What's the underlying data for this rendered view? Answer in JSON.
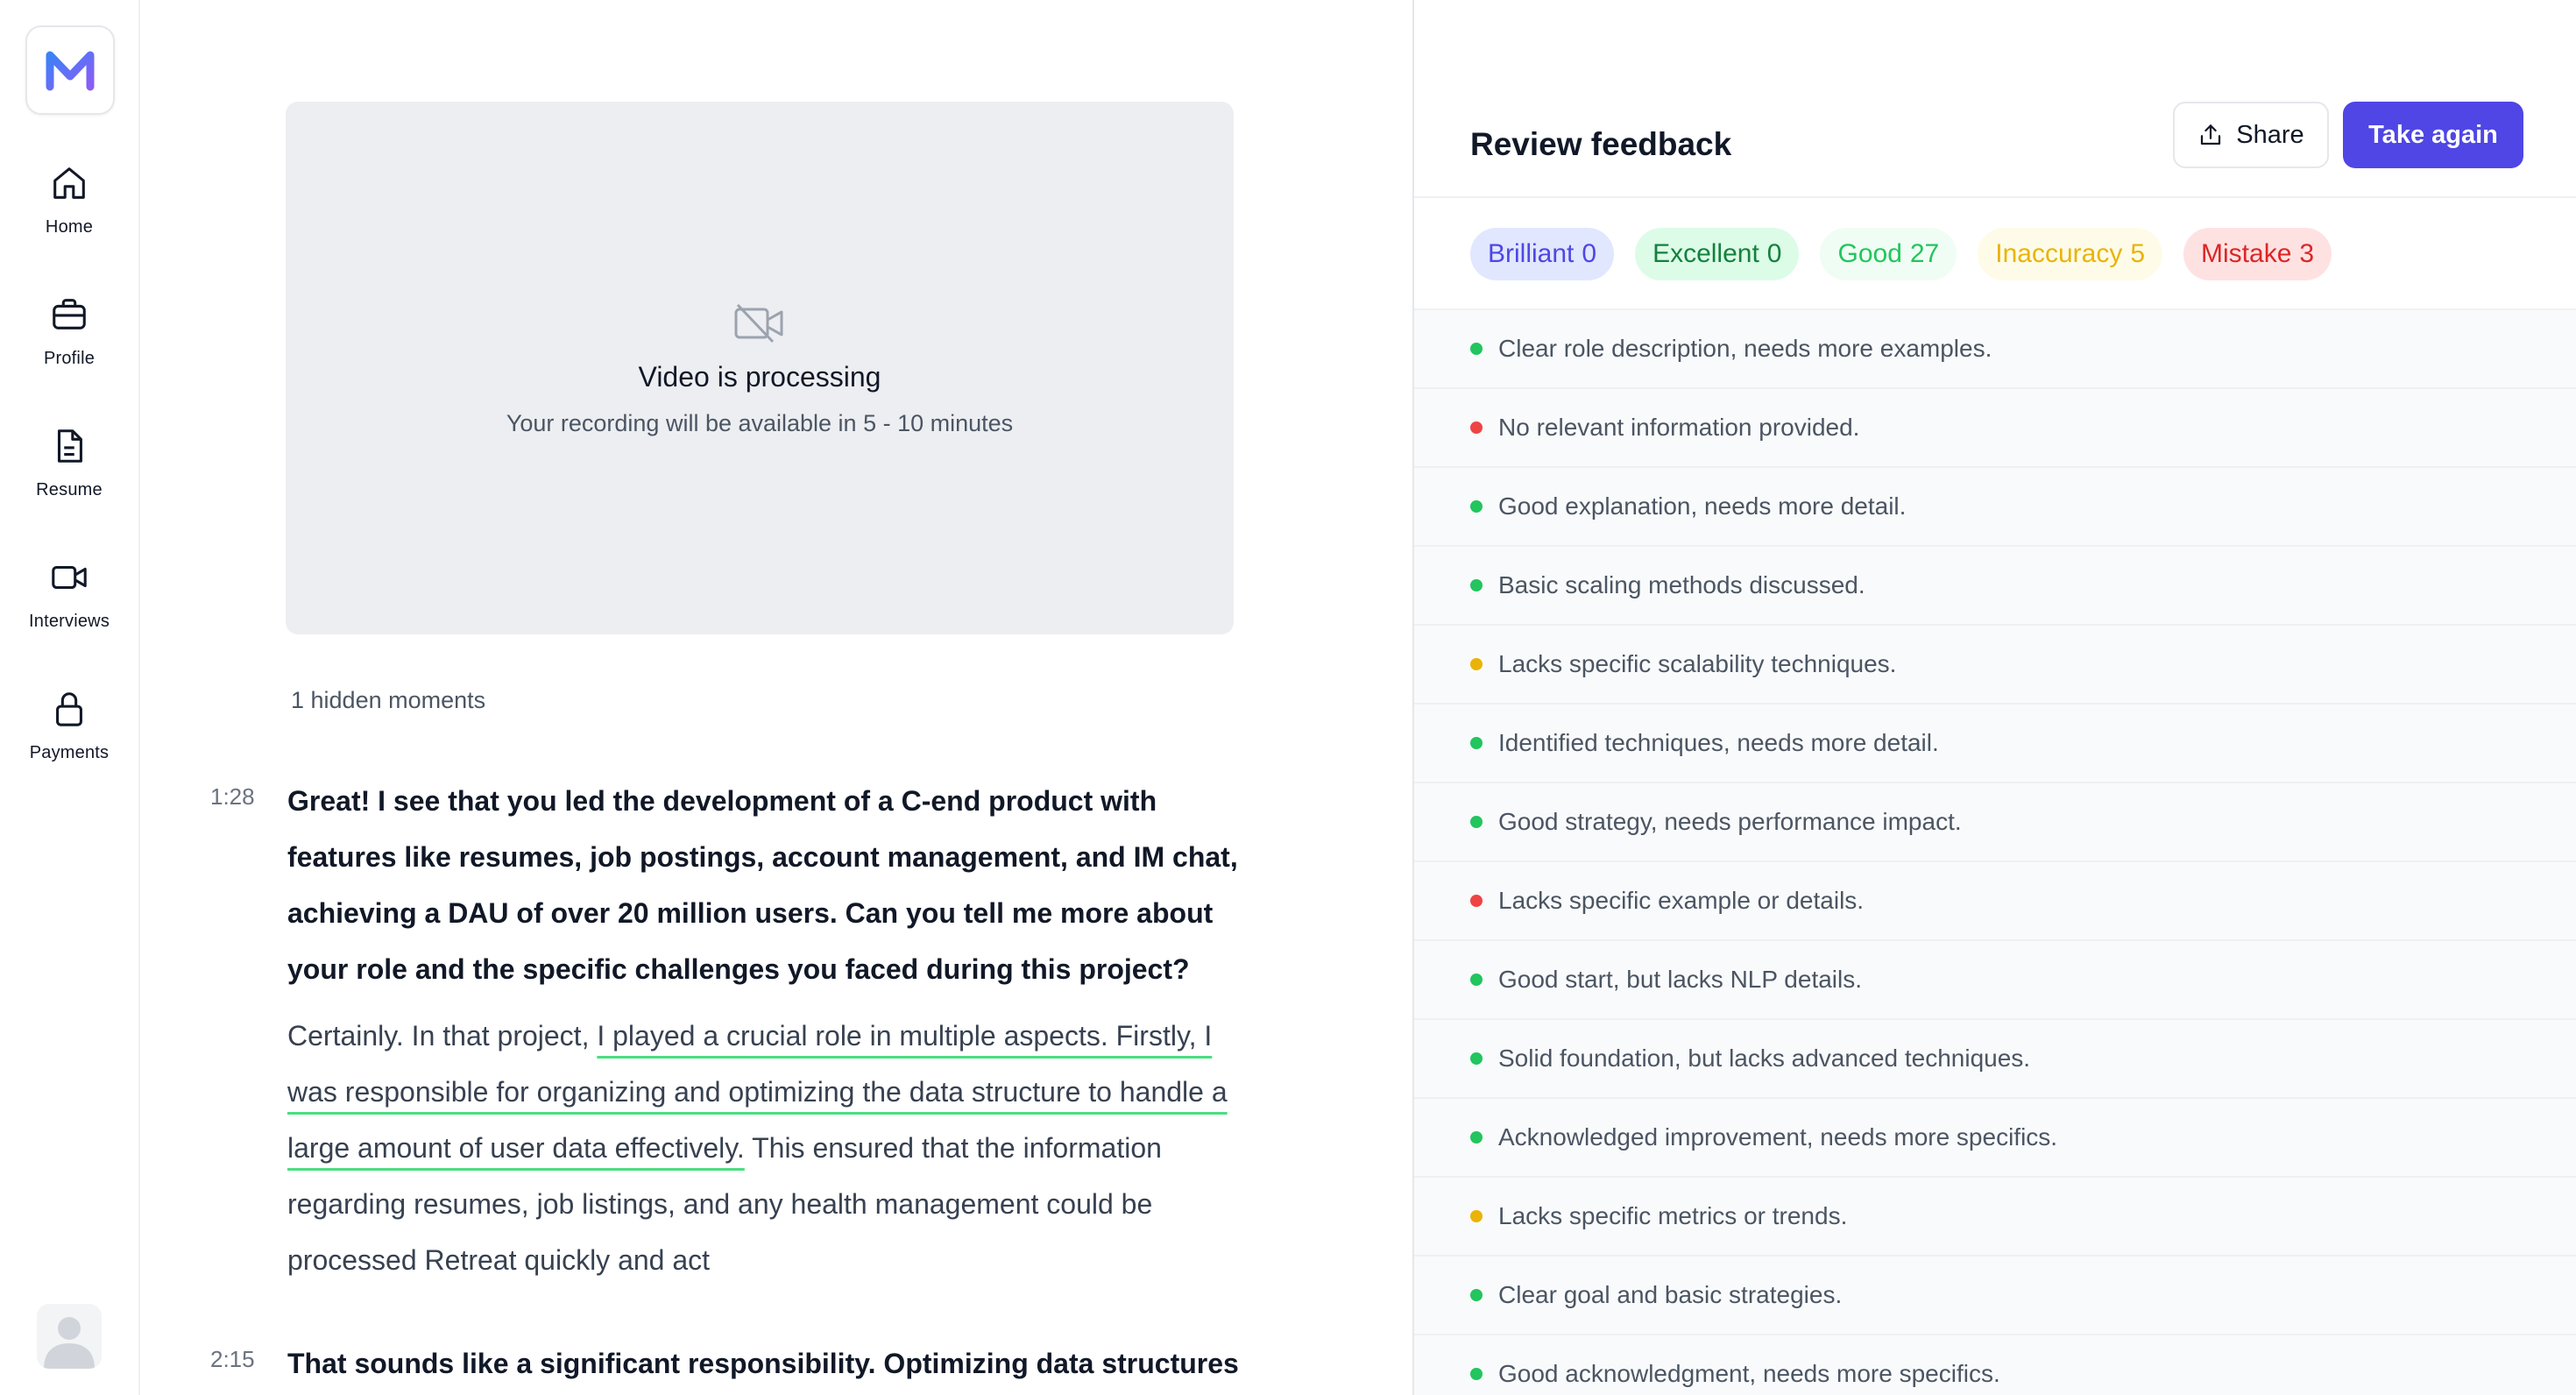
{
  "sidebar": {
    "items": [
      {
        "label": "Home",
        "icon": "home-icon"
      },
      {
        "label": "Profile",
        "icon": "briefcase-icon"
      },
      {
        "label": "Resume",
        "icon": "document-icon"
      },
      {
        "label": "Interviews",
        "icon": "video-camera-icon"
      },
      {
        "label": "Payments",
        "icon": "lock-icon"
      }
    ]
  },
  "video": {
    "title": "Video is processing",
    "subtitle": "Your recording will be available in 5 - 10 minutes"
  },
  "transcript": {
    "hidden_moments": "1 hidden moments",
    "entries": [
      {
        "time": "1:28",
        "question": "Great! I see that you led the development of a C-end product with features like resumes, job postings, account management, and IM chat, achieving a DAU of over 20 million users. Can you tell me more about your role and the specific challenges you faced during this project?",
        "answer_before": "Certainly. In that project, ",
        "answer_highlight": "I played a crucial role in multiple aspects. Firstly, I was responsible for organizing and optimizing the data structure to handle a large amount of user data effectively.",
        "answer_after": " This ensured that the information regarding resumes, job listings, and any health management could be processed Retreat quickly and act"
      },
      {
        "time": "2:15",
        "question": "That sounds like a significant responsibility. Optimizing data structures"
      }
    ]
  },
  "review": {
    "title": "Review feedback",
    "share_label": "Share",
    "take_again_label": "Take again",
    "chips": [
      {
        "label": "Brilliant",
        "count": "0",
        "bg": "#e0e7ff",
        "fg": "#4f46e5"
      },
      {
        "label": "Excellent",
        "count": "0",
        "bg": "#dcfce7",
        "fg": "#15803d"
      },
      {
        "label": "Good",
        "count": "27",
        "bg": "#f0fdf4",
        "fg": "#22c55e"
      },
      {
        "label": "Inaccuracy",
        "count": "5",
        "bg": "#fefce8",
        "fg": "#eab308"
      },
      {
        "label": "Mistake",
        "count": "3",
        "bg": "#fee2e2",
        "fg": "#dc2626"
      }
    ],
    "items": [
      {
        "status": "good",
        "color": "#22c55e",
        "text": "Clear role description, needs more examples."
      },
      {
        "status": "mistake",
        "color": "#ef4444",
        "text": "No relevant information provided."
      },
      {
        "status": "good",
        "color": "#22c55e",
        "text": "Good explanation, needs more detail."
      },
      {
        "status": "good",
        "color": "#22c55e",
        "text": "Basic scaling methods discussed."
      },
      {
        "status": "inaccuracy",
        "color": "#eab308",
        "text": "Lacks specific scalability techniques."
      },
      {
        "status": "good",
        "color": "#22c55e",
        "text": "Identified techniques, needs more detail."
      },
      {
        "status": "good",
        "color": "#22c55e",
        "text": "Good strategy, needs performance impact."
      },
      {
        "status": "mistake",
        "color": "#ef4444",
        "text": "Lacks specific example or details."
      },
      {
        "status": "good",
        "color": "#22c55e",
        "text": "Good start, but lacks NLP details."
      },
      {
        "status": "good",
        "color": "#22c55e",
        "text": "Solid foundation, but lacks advanced techniques."
      },
      {
        "status": "good",
        "color": "#22c55e",
        "text": "Acknowledged improvement, needs more specifics."
      },
      {
        "status": "inaccuracy",
        "color": "#eab308",
        "text": "Lacks specific metrics or trends."
      },
      {
        "status": "good",
        "color": "#22c55e",
        "text": "Clear goal and basic strategies."
      },
      {
        "status": "good",
        "color": "#22c55e",
        "text": "Good acknowledgment, needs more specifics."
      }
    ]
  }
}
